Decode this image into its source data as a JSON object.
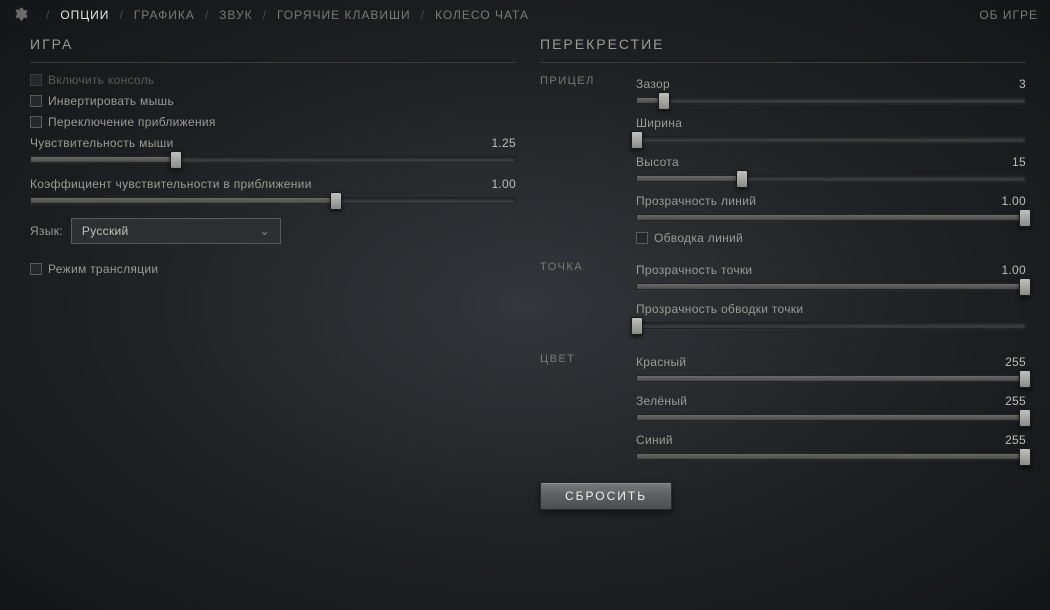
{
  "nav": {
    "tabs": [
      "ОПЦИИ",
      "ГРАФИКА",
      "ЗВУК",
      "ГОРЯЧИЕ КЛАВИШИ",
      "КОЛЕСО ЧАТА"
    ],
    "active_index": 0,
    "about": "ОБ ИГРЕ"
  },
  "game": {
    "title": "ИГРА",
    "enable_console": {
      "label": "Включить консоль",
      "checked": false,
      "disabled": true
    },
    "invert_mouse": {
      "label": "Инвертировать мышь",
      "checked": false
    },
    "toggle_zoom": {
      "label": "Переключение приближения",
      "checked": false
    },
    "mouse_sens": {
      "label": "Чувствительность мыши",
      "value": "1.25",
      "pct": 30
    },
    "zoom_sens": {
      "label": "Коэффициент чувствительности в приближении",
      "value": "1.00",
      "pct": 63
    },
    "language_label": "Язык:",
    "language_value": "Русский",
    "stream_mode": {
      "label": "Режим трансляции",
      "checked": false
    }
  },
  "crosshair": {
    "title": "ПЕРЕКРЕСТИЕ",
    "groups": {
      "reticle": {
        "label": "ПРИЦЕЛ",
        "gap": {
          "label": "Зазор",
          "value": "3",
          "pct": 7
        },
        "width": {
          "label": "Ширина",
          "value": "",
          "pct": 0
        },
        "height": {
          "label": "Высота",
          "value": "15",
          "pct": 27
        },
        "line_alpha": {
          "label": "Прозрачность линий",
          "value": "1.00",
          "pct": 100
        },
        "line_outline": {
          "label": "Обводка линий",
          "checked": false
        }
      },
      "dot": {
        "label": "ТОЧКА",
        "dot_alpha": {
          "label": "Прозрачность точки",
          "value": "1.00",
          "pct": 100
        },
        "dot_outline_alpha": {
          "label": "Прозрачность обводки точки",
          "value": "",
          "pct": 0
        }
      },
      "color": {
        "label": "ЦВЕТ",
        "red": {
          "label": "Красный",
          "value": "255",
          "pct": 100
        },
        "green": {
          "label": "Зелёный",
          "value": "255",
          "pct": 100
        },
        "blue": {
          "label": "Синий",
          "value": "255",
          "pct": 100
        }
      }
    },
    "reset_label": "СБРОСИТЬ"
  }
}
